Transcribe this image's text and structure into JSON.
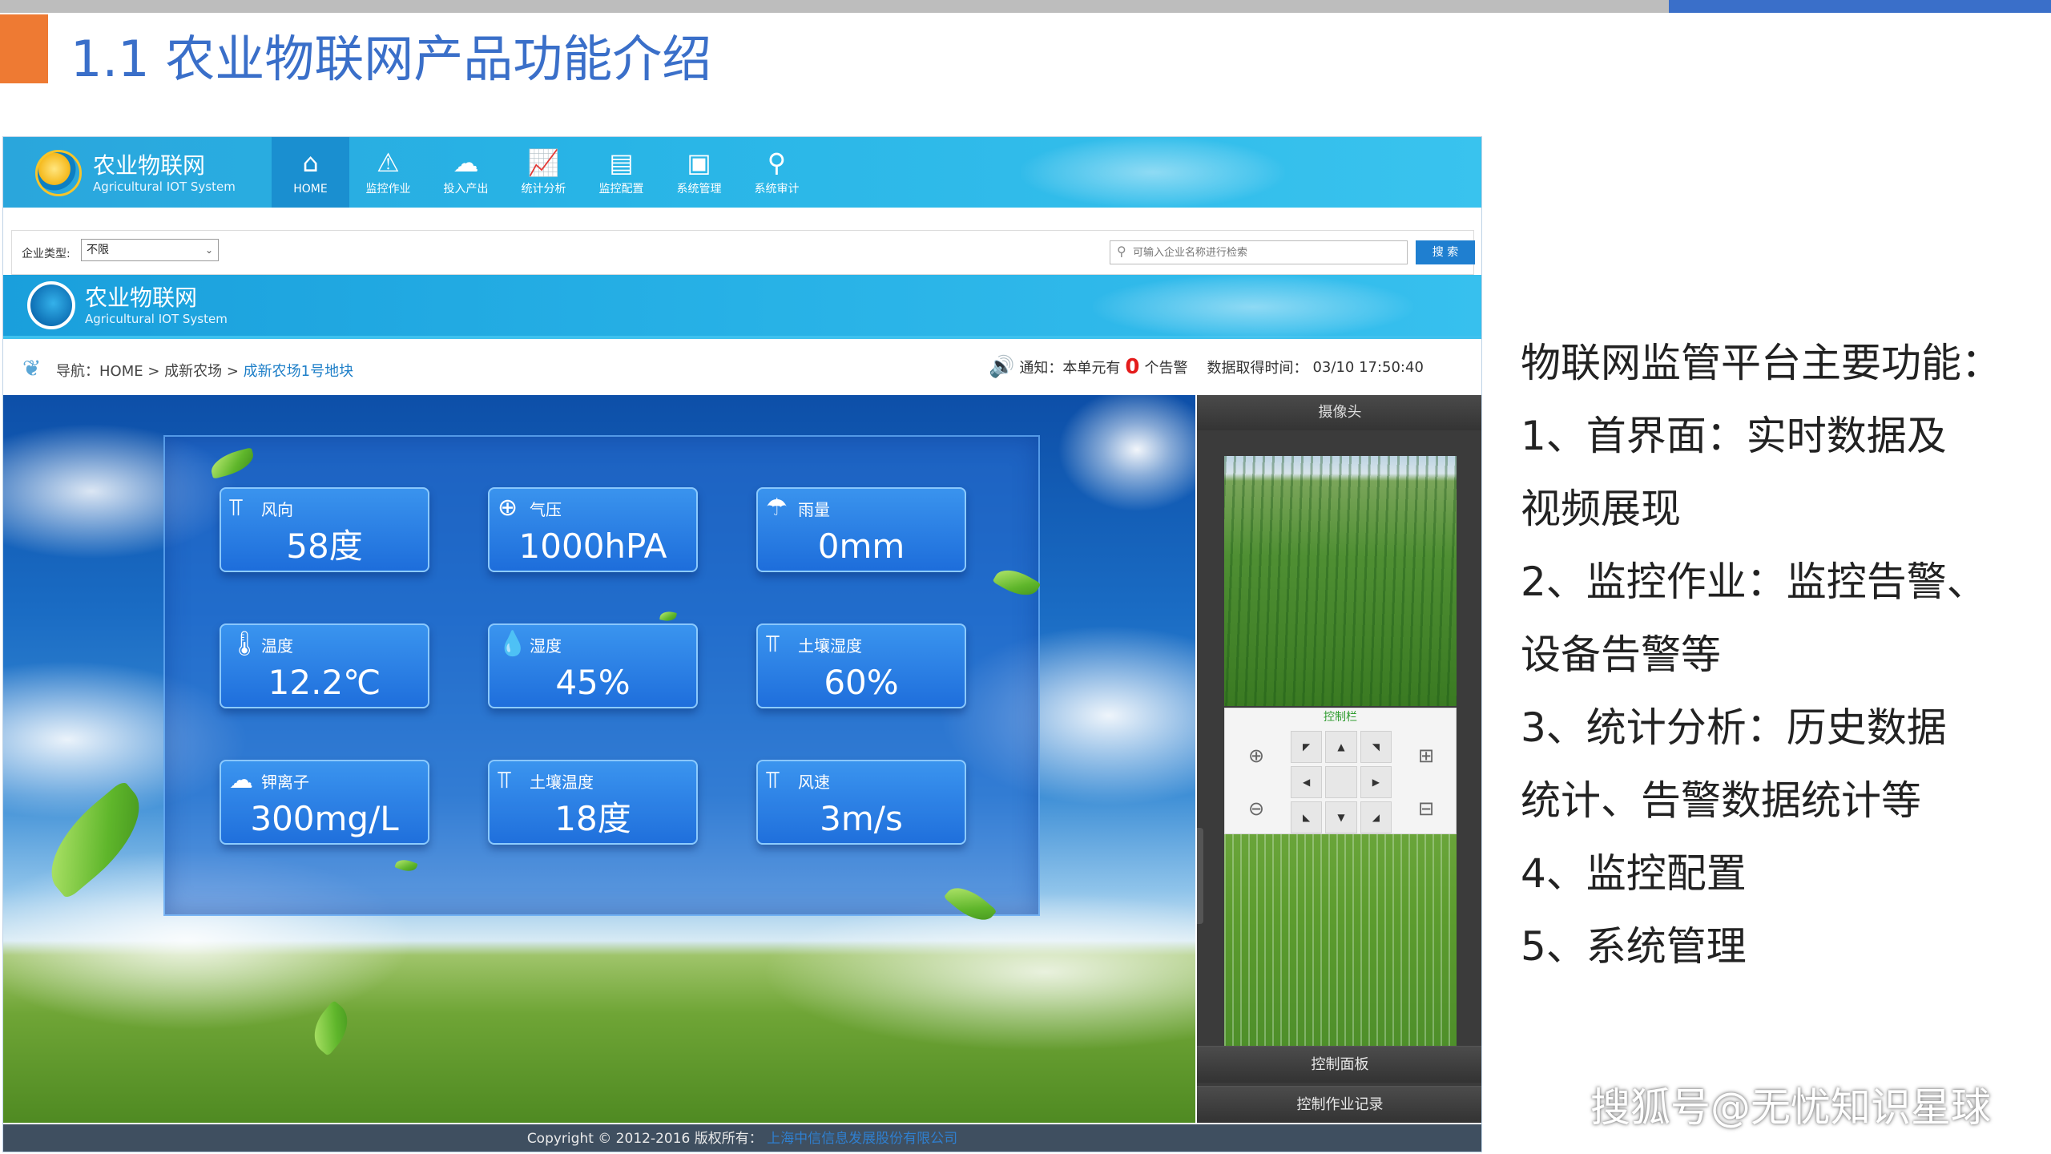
{
  "slide": {
    "title": "1.1 农业物联网产品功能介绍",
    "colors": {
      "accent_blue": "#3a6fc9",
      "accent_orange": "#ee7a33",
      "top_gray": "#bdbdbd"
    }
  },
  "app": {
    "brand": {
      "cn": "农业物联网",
      "en": "Agricultural IOT System"
    },
    "menu": [
      {
        "label": "HOME",
        "icon": "home-icon",
        "glyph": "⌂",
        "active": true
      },
      {
        "label": "监控作业",
        "icon": "warning-triangle-icon",
        "glyph": "⚠",
        "active": false
      },
      {
        "label": "投入产出",
        "icon": "clouds-icon",
        "glyph": "☁",
        "active": false
      },
      {
        "label": "统计分析",
        "icon": "chart-icon",
        "glyph": "📈",
        "active": false
      },
      {
        "label": "监控配置",
        "icon": "monitor-config-icon",
        "glyph": "▤",
        "active": false
      },
      {
        "label": "系统管理",
        "icon": "system-icon",
        "glyph": "▣",
        "active": false
      },
      {
        "label": "系统审计",
        "icon": "audit-icon",
        "glyph": "⚲",
        "active": false
      }
    ],
    "filter": {
      "label": "企业类型:",
      "selected": "不限",
      "search_placeholder": "可输入企业名称进行检索",
      "search_button": "搜  索"
    },
    "sub_brand": {
      "cn": "农业物联网",
      "en": "Agricultural IOT System"
    },
    "breadcrumb": {
      "prefix": "导航：HOME  >  成新农场  >",
      "current": "成新农场1号地块"
    },
    "notice": {
      "text_before": "通知：本单元有",
      "alarm_count": "0",
      "text_after": "个告警",
      "time_label": "数据取得时间：",
      "time_value": "03/10 17:50:40"
    },
    "sensors": [
      {
        "label": "风向",
        "value": "58度",
        "icon": "wind-direction-icon",
        "glyph": "⫪"
      },
      {
        "label": "气压",
        "value": "1000hPA",
        "icon": "pressure-icon",
        "glyph": "⊕"
      },
      {
        "label": "雨量",
        "value": "0mm",
        "icon": "rain-gauge-icon",
        "glyph": "☂"
      },
      {
        "label": "温度",
        "value": "12.2℃",
        "icon": "thermometer-icon",
        "glyph": "🌡"
      },
      {
        "label": "湿度",
        "value": "45%",
        "icon": "humidity-icon",
        "glyph": "💧"
      },
      {
        "label": "土壤湿度",
        "value": "60%",
        "icon": "soil-humidity-icon",
        "glyph": "⫪"
      },
      {
        "label": "钾离子",
        "value": "300mg/L",
        "icon": "ion-icon",
        "glyph": "☁"
      },
      {
        "label": "土壤温度",
        "value": "18度",
        "icon": "soil-temperature-icon",
        "glyph": "⫪"
      },
      {
        "label": "风速",
        "value": "3m/s",
        "icon": "wind-speed-icon",
        "glyph": "⫪"
      }
    ],
    "camera": {
      "header": "摄像头",
      "control_title": "控制栏",
      "buttons": [
        "控制面板",
        "控制作业记录"
      ]
    },
    "footer": {
      "text": "Copyright © 2012-2016 版权所有：",
      "owner": "上海中信信息发展股份有限公司"
    }
  },
  "right_text": [
    "物联网监管平台主要功能：",
    "1、首界面：实时数据及",
    "视频展现",
    "2、监控作业：监控告警、",
    "设备告警等",
    "3、统计分析：历史数据",
    "统计、告警数据统计等",
    "4、监控配置",
    "5、系统管理"
  ],
  "watermark": "搜狐号@无忧知识星球"
}
